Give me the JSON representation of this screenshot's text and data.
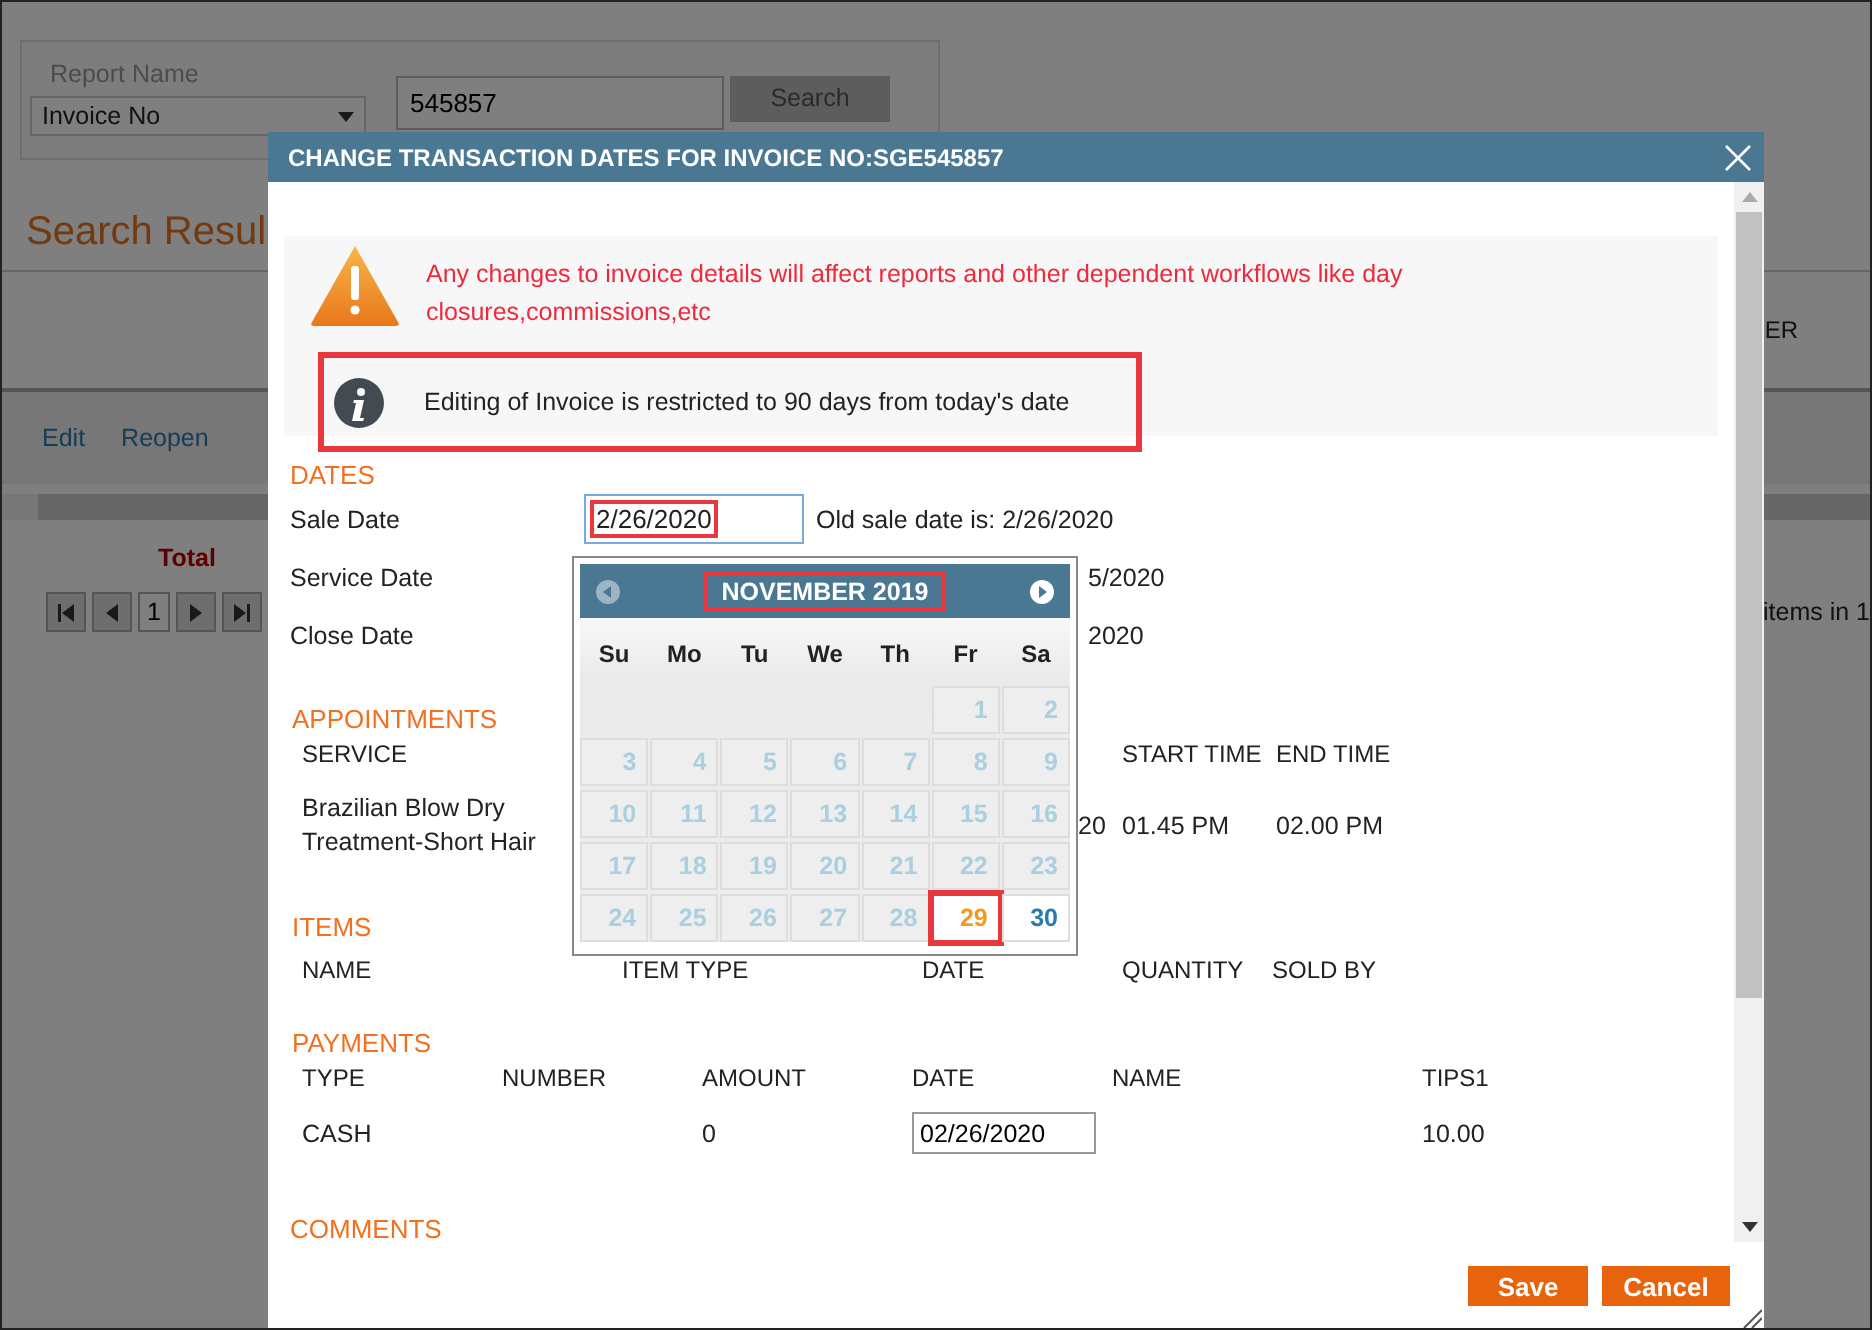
{
  "page": {
    "report_label": "Report Name",
    "report_select": "Invoice No",
    "search_value": "545857",
    "search_button": "Search",
    "results_title": "Search Resul",
    "header_fragment": "ER",
    "actions": [
      "Edit",
      "Reopen"
    ],
    "total_label": "Total",
    "pager_page": "1",
    "pager_fragment": "items in 1"
  },
  "dialog": {
    "title": "CHANGE TRANSACTION DATES FOR INVOICE NO:SGE545857",
    "warning": "Any changes to invoice details will affect reports and other dependent workflows like day closures,commissions,etc",
    "info": {
      "text": "Editing of Invoice is restricted to 90 days from today's date",
      "highlighted": true
    },
    "dates": {
      "heading": "DATES",
      "rows": [
        {
          "label": "Sale Date",
          "value": "2/26/2020",
          "highlighted": true,
          "focused": true,
          "note": "Old sale date is: 2/26/2020"
        },
        {
          "label": "Service Date",
          "note": "5/2020"
        },
        {
          "label": "Close Date",
          "note": "2020"
        }
      ]
    },
    "calendar": {
      "title": "NOVEMBER 2019",
      "title_highlighted": true,
      "prev_disabled": true,
      "weekdays": [
        "Su",
        "Mo",
        "Tu",
        "We",
        "Th",
        "Fr",
        "Sa"
      ],
      "weeks": [
        [
          {
            "label": "1",
            "disabled": true,
            "selected": false,
            "highlighted": false
          },
          {
            "label": "2",
            "disabled": true,
            "selected": false,
            "highlighted": false
          }
        ],
        [
          {
            "label": "3",
            "disabled": true,
            "selected": false,
            "highlighted": false
          },
          {
            "label": "4",
            "disabled": true,
            "selected": false,
            "highlighted": false
          },
          {
            "label": "5",
            "disabled": true,
            "selected": false,
            "highlighted": false
          },
          {
            "label": "6",
            "disabled": true,
            "selected": false,
            "highlighted": false
          },
          {
            "label": "7",
            "disabled": true,
            "selected": false,
            "highlighted": false
          },
          {
            "label": "8",
            "disabled": true,
            "selected": false,
            "highlighted": false
          },
          {
            "label": "9",
            "disabled": true,
            "selected": false,
            "highlighted": false
          }
        ],
        [
          {
            "label": "10",
            "disabled": true,
            "selected": false,
            "highlighted": false
          },
          {
            "label": "11",
            "disabled": true,
            "selected": false,
            "highlighted": false
          },
          {
            "label": "12",
            "disabled": true,
            "selected": false,
            "highlighted": false
          },
          {
            "label": "13",
            "disabled": true,
            "selected": false,
            "highlighted": false
          },
          {
            "label": "14",
            "disabled": true,
            "selected": false,
            "highlighted": false
          },
          {
            "label": "15",
            "disabled": true,
            "selected": false,
            "highlighted": false
          },
          {
            "label": "16",
            "disabled": true,
            "selected": false,
            "highlighted": false
          }
        ],
        [
          {
            "label": "17",
            "disabled": true,
            "selected": false,
            "highlighted": false
          },
          {
            "label": "18",
            "disabled": true,
            "selected": false,
            "highlighted": false
          },
          {
            "label": "19",
            "disabled": true,
            "selected": false,
            "highlighted": false
          },
          {
            "label": "20",
            "disabled": true,
            "selected": false,
            "highlighted": false
          },
          {
            "label": "21",
            "disabled": true,
            "selected": false,
            "highlighted": false
          },
          {
            "label": "22",
            "disabled": true,
            "selected": false,
            "highlighted": false
          },
          {
            "label": "23",
            "disabled": true,
            "selected": false,
            "highlighted": false
          }
        ],
        [
          {
            "label": "24",
            "disabled": true,
            "selected": false,
            "highlighted": false
          },
          {
            "label": "25",
            "disabled": true,
            "selected": false,
            "highlighted": false
          },
          {
            "label": "26",
            "disabled": true,
            "selected": false,
            "highlighted": false
          },
          {
            "label": "27",
            "disabled": true,
            "selected": false,
            "highlighted": false
          },
          {
            "label": "28",
            "disabled": true,
            "selected": false,
            "highlighted": false
          },
          {
            "label": "29",
            "disabled": false,
            "selected": true,
            "highlighted": true
          },
          {
            "label": "30",
            "disabled": false,
            "selected": false,
            "highlighted": false
          }
        ]
      ]
    },
    "appointments": {
      "heading": "APPOINTMENTS",
      "columns": [
        "SERVICE",
        "START TIME",
        "END TIME"
      ],
      "row": {
        "service": "Brazilian Blow Dry Treatment-Short Hair",
        "date_fragment": "20",
        "start": "01.45 PM",
        "end": "02.00 PM"
      }
    },
    "items": {
      "heading": "ITEMS",
      "columns": [
        "NAME",
        "ITEM TYPE",
        "DATE",
        "QUANTITY",
        "SOLD BY"
      ]
    },
    "payments": {
      "heading": "PAYMENTS",
      "columns": [
        "TYPE",
        "NUMBER",
        "AMOUNT",
        "DATE",
        "NAME",
        "TIPS1"
      ],
      "row": {
        "type": "CASH",
        "amount": "0",
        "date": "02/26/2020",
        "tips": "10.00"
      }
    },
    "comments_heading": "COMMENTS",
    "buttons": [
      "Save",
      "Cancel"
    ]
  }
}
